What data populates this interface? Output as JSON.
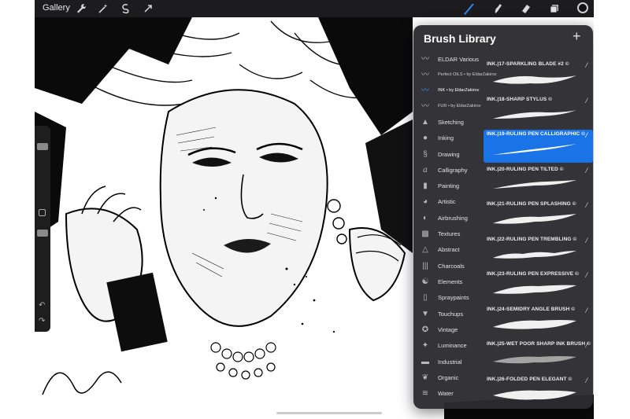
{
  "topbar": {
    "gallery_label": "Gallery",
    "left_icons": [
      "wrench-icon",
      "magic-wand-icon",
      "selection-icon",
      "transform-arrow-icon"
    ],
    "right_icons": [
      "brush-icon",
      "smudge-icon",
      "eraser-icon",
      "layers-icon"
    ],
    "active_tool": "brush-icon",
    "active_color": "#111111"
  },
  "brush_library": {
    "title": "Brush Library",
    "add_label": "+",
    "sets": [
      {
        "label": "ELDAR Various",
        "icon": "custom-brush-icon",
        "style": "normal"
      },
      {
        "label": "Perfect OILS • by EldarZakirov",
        "icon": "custom-brush-icon",
        "style": "small"
      },
      {
        "label": "INK • by EldarZakirov",
        "icon": "custom-brush-icon",
        "style": "small",
        "active": true
      },
      {
        "label": "FUR • by EldarZakirov",
        "icon": "custom-brush-icon",
        "style": "small"
      },
      {
        "label": "Sketching",
        "icon": "pencil-tip-icon",
        "style": "normal"
      },
      {
        "label": "Inking",
        "icon": "ink-drop-icon",
        "style": "normal"
      },
      {
        "label": "Drawing",
        "icon": "squiggle-icon",
        "style": "normal"
      },
      {
        "label": "Calligraphy",
        "icon": "calligraphy-icon",
        "style": "normal"
      },
      {
        "label": "Painting",
        "icon": "paintbrush-icon",
        "style": "normal"
      },
      {
        "label": "Artistic",
        "icon": "palette-icon",
        "style": "normal"
      },
      {
        "label": "Airbrushing",
        "icon": "airbrush-icon",
        "style": "normal"
      },
      {
        "label": "Textures",
        "icon": "texture-icon",
        "style": "normal"
      },
      {
        "label": "Abstract",
        "icon": "triangle-icon",
        "style": "normal"
      },
      {
        "label": "Charcoals",
        "icon": "charcoal-icon",
        "style": "normal"
      },
      {
        "label": "Elements",
        "icon": "yin-yang-icon",
        "style": "normal"
      },
      {
        "label": "Spraypaints",
        "icon": "spray-can-icon",
        "style": "normal"
      },
      {
        "label": "Touchups",
        "icon": "touchup-icon",
        "style": "normal"
      },
      {
        "label": "Vintage",
        "icon": "star-badge-icon",
        "style": "normal"
      },
      {
        "label": "Luminance",
        "icon": "sparkle-icon",
        "style": "normal"
      },
      {
        "label": "Industrial",
        "icon": "anvil-icon",
        "style": "normal"
      },
      {
        "label": "Organic",
        "icon": "leaf-icon",
        "style": "normal"
      },
      {
        "label": "Water",
        "icon": "waves-icon",
        "style": "normal"
      }
    ],
    "brushes": [
      {
        "name": "INK.|17-SPARKLING BLADE #2 ©",
        "selected": false
      },
      {
        "name": "INK.|18-SHARP STYLUS ©",
        "selected": false
      },
      {
        "name": "INK.|19-RULING PEN CALLIGRAPHIC ©",
        "selected": true
      },
      {
        "name": "INK.|20-RULING PEN TILTED ©",
        "selected": false
      },
      {
        "name": "INK.|21-RULING PEN SPLASHING ©",
        "selected": false
      },
      {
        "name": "INK.|22-RULING PEN TREMBLING ©",
        "selected": false
      },
      {
        "name": "INK.|23-RULING PEN EXPRESSIVE ©",
        "selected": false
      },
      {
        "name": "INK.|24-SEMIDRY ANGLE BRUSH ©",
        "selected": false
      },
      {
        "name": "INK.|25-WET POOR SHARP INK BRUSH ©",
        "selected": false
      },
      {
        "name": "INK.|26-FOLDED PEN ELEGANT ©",
        "selected": false
      }
    ]
  },
  "sidebar": {
    "icons": [
      "modify-square-icon",
      "undo-arrow-icon",
      "redo-arrow-icon"
    ]
  }
}
